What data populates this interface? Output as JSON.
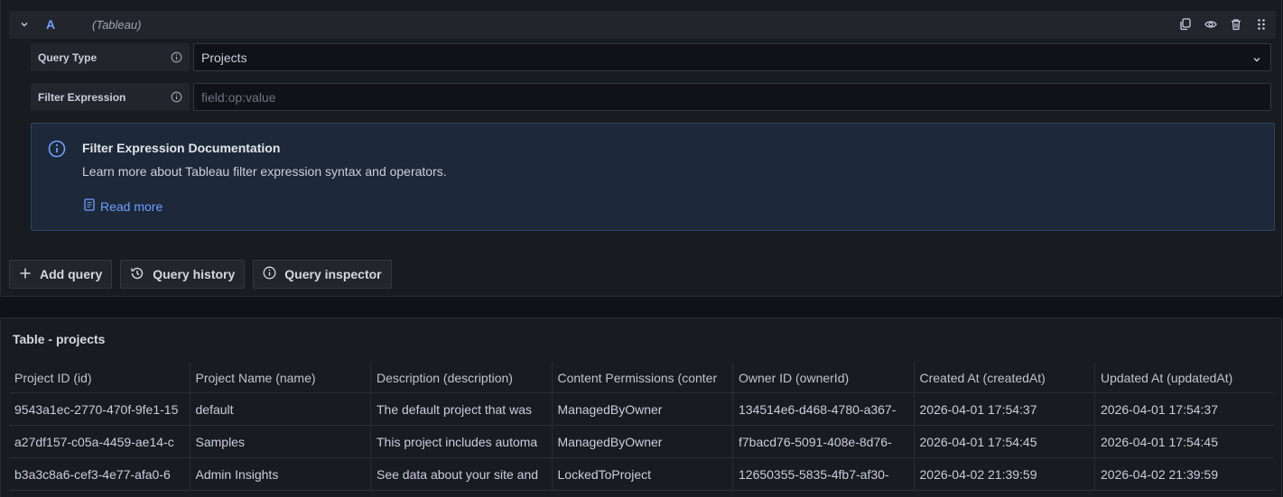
{
  "query": {
    "ref_id": "A",
    "datasource": "(Tableau)",
    "fields": [
      {
        "label": "Query Type",
        "value": "Projects"
      },
      {
        "label": "Filter Expression",
        "placeholder": "field:op:value"
      }
    ],
    "header_icons": [
      "duplicate-icon",
      "eye-icon",
      "trash-icon",
      "drag-handle-icon"
    ]
  },
  "doc": {
    "title": "Filter Expression Documentation",
    "description": "Learn more about Tableau filter expression syntax and operators.",
    "link": "Read more"
  },
  "buttons": {
    "add_query": "Add query",
    "query_history": "Query history",
    "query_inspector": "Query inspector"
  },
  "table": {
    "title": "Table - projects",
    "columns": [
      "Project ID (id)",
      "Project Name (name)",
      "Description (description)",
      "Content Permissions (conter",
      "Owner ID (ownerId)",
      "Created At (createdAt)",
      "Updated At (updatedAt)"
    ],
    "rows": [
      [
        "9543a1ec-2770-470f-9fe1-15",
        "default",
        "The default project that was",
        "ManagedByOwner",
        "134514e6-d468-4780-a367-",
        "2026-04-01 17:54:37",
        "2026-04-01 17:54:37"
      ],
      [
        "a27df157-c05a-4459-ae14-c",
        "Samples",
        "This project includes automa",
        "ManagedByOwner",
        "f7bacd76-5091-408e-8d76-",
        "2026-04-01 17:54:45",
        "2026-04-01 17:54:45"
      ],
      [
        "b3a3c8a6-cef3-4e77-afa0-6",
        "Admin Insights",
        "See data about your site and",
        "LockedToProject",
        "12650355-5835-4fb7-af30-",
        "2026-04-02 21:39:59",
        "2026-04-02 21:39:59"
      ]
    ]
  },
  "colors": {
    "accent": "#6e9fff",
    "panel": "#181b1f",
    "background": "#111217",
    "info_box": "#1d2839"
  }
}
